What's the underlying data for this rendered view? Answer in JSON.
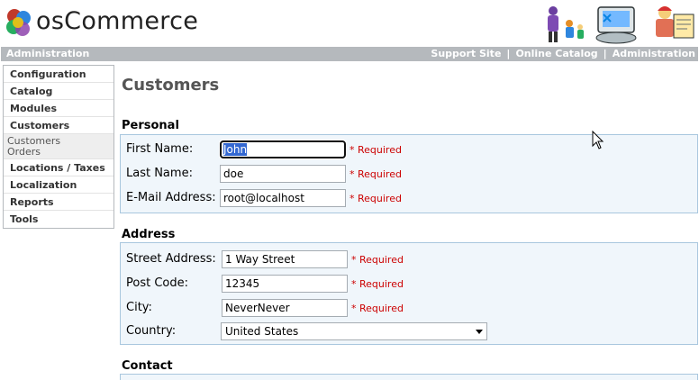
{
  "header": {
    "logo_text": "osCommerce"
  },
  "topbar": {
    "left_label": "Administration",
    "links": [
      "Support Site",
      "Online Catalog",
      "Administration"
    ],
    "separator": "|"
  },
  "sidebar": {
    "items": [
      {
        "label": "Configuration"
      },
      {
        "label": "Catalog"
      },
      {
        "label": "Modules"
      },
      {
        "label": "Customers"
      }
    ],
    "subitems": [
      "Customers",
      "Orders"
    ],
    "items_after": [
      {
        "label": "Locations / Taxes"
      },
      {
        "label": "Localization"
      },
      {
        "label": "Reports"
      },
      {
        "label": "Tools"
      }
    ]
  },
  "page": {
    "title": "Customers"
  },
  "personal": {
    "title": "Personal",
    "first_name_label": "First Name:",
    "first_name_value": "John",
    "last_name_label": "Last Name:",
    "last_name_value": "doe",
    "email_label": "E-Mail Address:",
    "email_value": "root@localhost",
    "required": "* Required"
  },
  "address": {
    "title": "Address",
    "street_label": "Street Address:",
    "street_value": "1 Way Street",
    "postcode_label": "Post Code:",
    "postcode_value": "12345",
    "city_label": "City:",
    "city_value": "NeverNever",
    "country_label": "Country:",
    "country_value": "United States",
    "required": "* Required"
  },
  "contact": {
    "title": "Contact"
  },
  "colors": {
    "bar": "#b5b9bd",
    "fieldset_bg": "#f0f6fb",
    "fieldset_border": "#a9c7de",
    "required": "#cc0000",
    "selection": "#316ac5"
  }
}
